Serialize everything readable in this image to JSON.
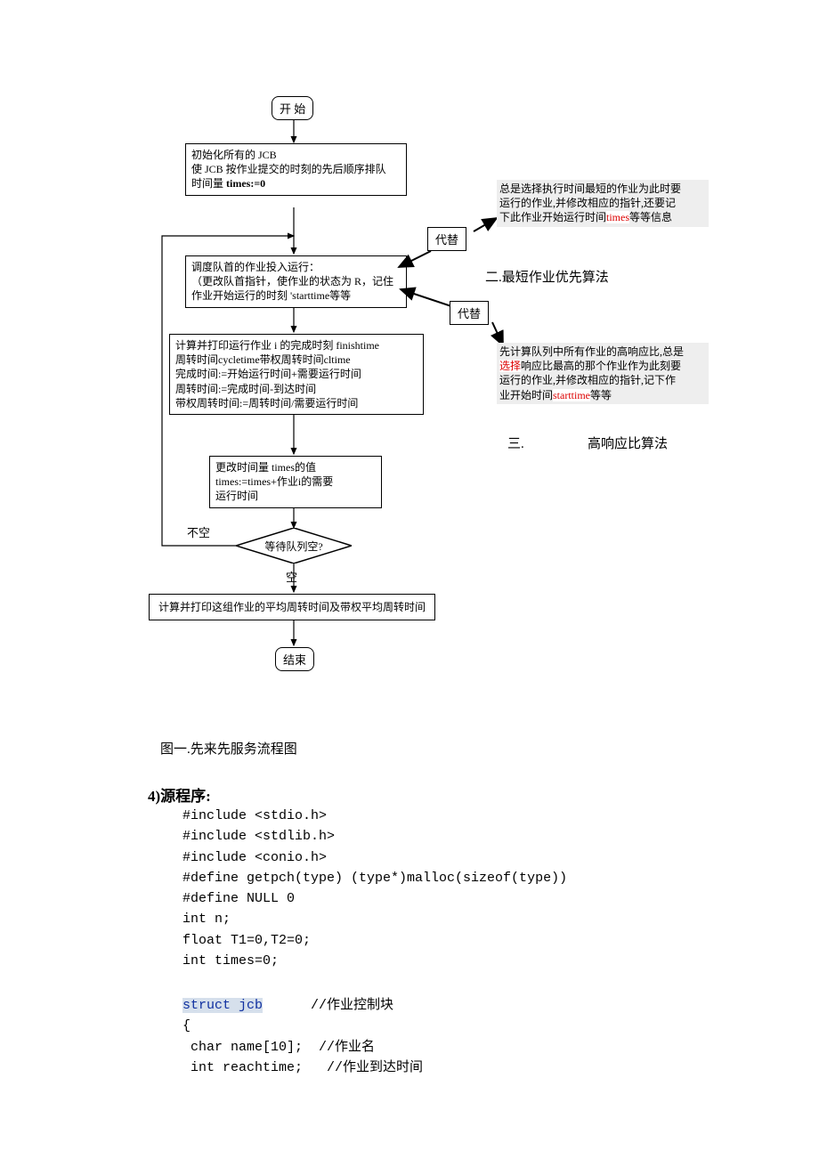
{
  "flow": {
    "start": "开 始",
    "init_l1": "初始化所有的 JCB",
    "init_l2": "使 JCB 按作业提交的时刻的先后顺序排队",
    "init_l3a": "时间量",
    "init_l3b": "times:=0",
    "dispatch_l1": "调度队首的作业投入运行：",
    "dispatch_l2": "（更改队首指针，使作业的状态为 R，记住",
    "dispatch_l3": "作业开始运行的时刻 'starttime等等",
    "calc_l1": "计算并打印运行作业 i 的完成时刻 finishtime",
    "calc_l2": "周转时间cycletime带权周转时间cltime",
    "calc_l3": "完成时间:=开始运行时间+需要运行时间",
    "calc_l4": " 周转时间:=完成时间-到达时间",
    "calc_l5": "带权周转时间:=周转时间/需要运行时间",
    "update_l1": "更改时间量 times的值",
    "update_l2": "times:=times+作业i的需要",
    "update_l3": "运行时间",
    "decision": "等待队列空?",
    "dec_no": "不空",
    "dec_yes": "空",
    "final": "计算并打印这组作业的平均周转时间及带权平均周转时间",
    "end": "结束"
  },
  "side": {
    "replace": "代替",
    "annot1_l1": "总是选择执行时间最短的作业为此时要",
    "annot1_l2": "运行的作业,并修改相应的指针,还要记",
    "annot1_l3a": "下此作业开始运行时间",
    "annot1_l3b": "times",
    "annot1_l3c": "等等信息",
    "title2": "二.最短作业优先算法",
    "annot2_l1": "先计算队列中所有作业的高响应比,总是",
    "annot2_l2a": "选择",
    "annot2_l2b": "响应比最高的那个作业作为此刻要",
    "annot2_l3": "运行的作业,并修改相应的指针,记下作",
    "annot2_l4a": "业开始时间",
    "annot2_l4b": "starttime",
    "annot2_l4c": "等等",
    "title3a": "三.",
    "title3b": "高响应比算法"
  },
  "caption": "图一.先来先服务流程图",
  "section": "4)源程序:",
  "code": {
    "l1": "#include <stdio.h>",
    "l2": "#include <stdlib.h>",
    "l3": "#include <conio.h>",
    "l4": "#define getpch(type) (type*)malloc(sizeof(type))",
    "l5": "#define NULL 0",
    "l6": "int n;",
    "l7": "float T1=0,T2=0;",
    "l8": "int times=0;",
    "kw": "struct jcb",
    "l10b": "      //作业控制块",
    "l11": "{",
    "l12": " char name[10];  //作业名",
    "l13": " int reachtime;   //作业到达时间"
  }
}
